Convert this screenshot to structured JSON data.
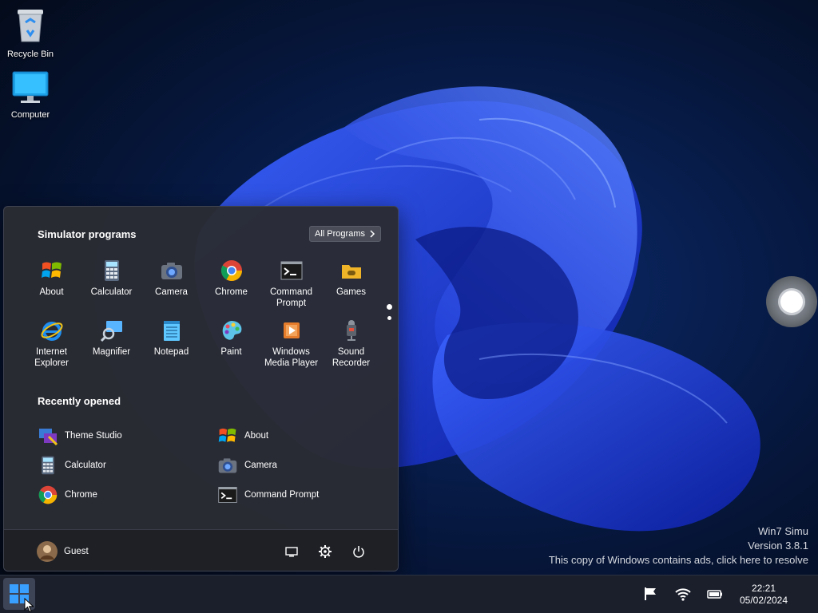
{
  "desktop": {
    "icons": [
      {
        "label": "Recycle Bin",
        "icon": "recycle-bin-icon"
      },
      {
        "label": "Computer",
        "icon": "computer-monitor-icon"
      }
    ]
  },
  "start_menu": {
    "programs_title": "Simulator programs",
    "all_programs_label": "All Programs",
    "apps": [
      {
        "label": "About",
        "icon": "windows-flag-icon"
      },
      {
        "label": "Calculator",
        "icon": "calculator-icon"
      },
      {
        "label": "Camera",
        "icon": "camera-icon"
      },
      {
        "label": "Chrome",
        "icon": "chrome-icon"
      },
      {
        "label": "Command Prompt",
        "icon": "command-prompt-icon"
      },
      {
        "label": "Games",
        "icon": "games-icon"
      },
      {
        "label": "Internet Explorer",
        "icon": "internet-explorer-icon"
      },
      {
        "label": "Magnifier",
        "icon": "magnifier-icon"
      },
      {
        "label": "Notepad",
        "icon": "notepad-icon"
      },
      {
        "label": "Paint",
        "icon": "paint-palette-icon"
      },
      {
        "label": "Windows Media Player",
        "icon": "media-player-icon"
      },
      {
        "label": "Sound Recorder",
        "icon": "microphone-icon"
      }
    ],
    "recent_title": "Recently opened",
    "recent": [
      {
        "label": "Theme Studio",
        "icon": "theme-studio-icon"
      },
      {
        "label": "About",
        "icon": "windows-flag-icon"
      },
      {
        "label": "Calculator",
        "icon": "calculator-icon"
      },
      {
        "label": "Camera",
        "icon": "camera-icon"
      },
      {
        "label": "Chrome",
        "icon": "chrome-icon"
      },
      {
        "label": "Command Prompt",
        "icon": "command-prompt-icon"
      }
    ],
    "user_name": "Guest",
    "footer_buttons": [
      "display-icon",
      "gear-icon",
      "power-icon"
    ]
  },
  "watermark": {
    "line1": "Win7 Simu",
    "line2": "Version 3.8.1",
    "line3": "This copy of Windows contains ads, click here to resolve"
  },
  "taskbar": {
    "time": "22:21",
    "date": "05/02/2024",
    "tray_icons": [
      "flag-icon",
      "wifi-icon",
      "battery-icon"
    ]
  },
  "colors": {
    "wallpaper_base": "#050d1f",
    "wallpaper_bloom": "#1a3cff",
    "menu_background": "#2a2c34",
    "taskbar": "#1b1f2c",
    "accent": "#2f8df5"
  }
}
